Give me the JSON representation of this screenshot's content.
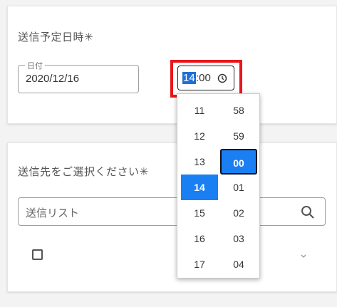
{
  "schedule": {
    "title": "送信予定日時✳",
    "date_label": "日付",
    "date_value": "2020/12/16",
    "time_hour": "14",
    "time_rest": ":00"
  },
  "time_picker": {
    "hours": [
      "11",
      "12",
      "13",
      "14",
      "15",
      "16",
      "17"
    ],
    "minutes": [
      "58",
      "59",
      "00",
      "01",
      "02",
      "03",
      "04"
    ],
    "selected_hour": "14",
    "selected_minute": "00",
    "accent_color": "#1a7ff2"
  },
  "destination": {
    "title": "送信先をご選択ください✳",
    "search_placeholder": "送信リスト"
  },
  "icons": {
    "time": "clock-icon",
    "search": "search-icon",
    "expand": "chevron-down-icon"
  },
  "colors": {
    "highlight": "#e8161b"
  }
}
